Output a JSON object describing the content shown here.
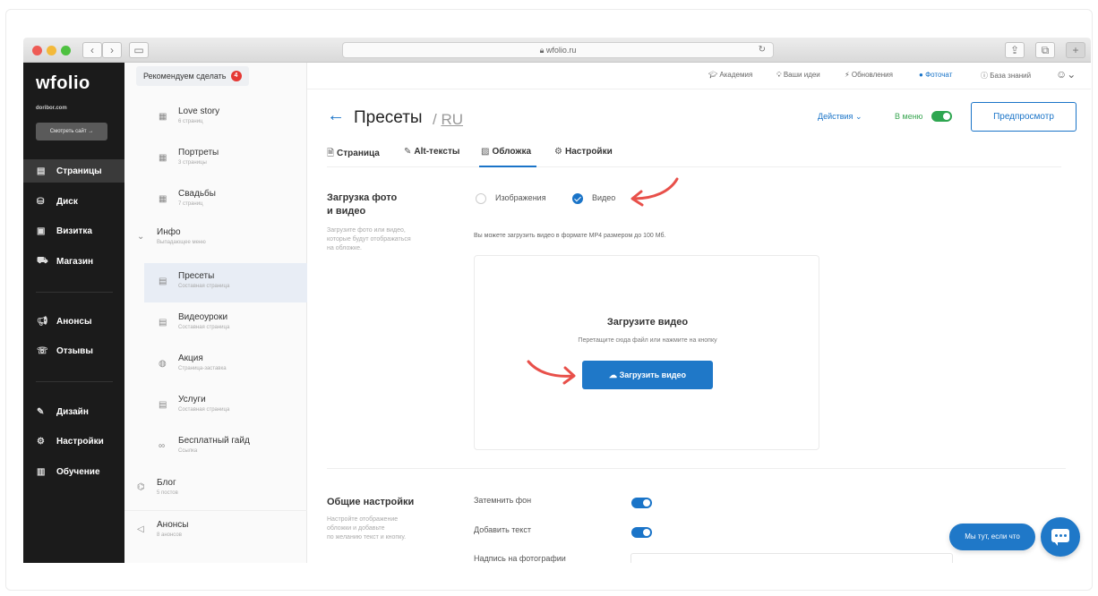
{
  "browser": {
    "address": "wfolio.ru"
  },
  "sidebar": {
    "logo": "wfolio",
    "site": "doribor.com",
    "view_site": "Смотреть сайт →",
    "items": [
      {
        "label": "Страницы",
        "icon": "page-icon"
      },
      {
        "label": "Диск",
        "icon": "disk-icon"
      },
      {
        "label": "Визитка",
        "icon": "card-icon"
      },
      {
        "label": "Магазин",
        "icon": "cart-icon"
      },
      {
        "label": "Анонсы",
        "icon": "megaphone-icon"
      },
      {
        "label": "Отзывы",
        "icon": "reviews-icon"
      },
      {
        "label": "Дизайн",
        "icon": "brush-icon"
      },
      {
        "label": "Настройки",
        "icon": "gear-icon"
      },
      {
        "label": "Обучение",
        "icon": "book-icon"
      }
    ]
  },
  "pages_tree": {
    "recommend": "Рекомендуем сделать",
    "recommend_count": "4",
    "items": [
      {
        "title": "Love story",
        "sub": "6 страниц"
      },
      {
        "title": "Портреты",
        "sub": "3 страницы"
      },
      {
        "title": "Свадьбы",
        "sub": "7 страниц"
      }
    ],
    "group": {
      "title": "Инфо",
      "sub": "Выпадающее меню"
    },
    "children": [
      {
        "title": "Пресеты",
        "sub": "Составная страница"
      },
      {
        "title": "Видеоуроки",
        "sub": "Составная страница"
      },
      {
        "title": "Акция",
        "sub": "Страница-заставка"
      },
      {
        "title": "Услуги",
        "sub": "Составная страница"
      },
      {
        "title": "Бесплатный гайд",
        "sub": "Ссылка"
      }
    ],
    "blog": {
      "title": "Блог",
      "sub": "5 постов"
    },
    "announcements": {
      "title": "Анонсы",
      "sub": "8 анонсов"
    }
  },
  "topbar": {
    "links": [
      "Академия",
      "Ваши идеи",
      "Обновления",
      "Фоточат",
      "База знаний"
    ]
  },
  "page": {
    "title": "Пресеты",
    "lang": "RU",
    "actions": "Действия",
    "in_menu": "В меню",
    "preview": "Предпросмотр",
    "tabs": [
      "Страница",
      "Alt-тексты",
      "Обложка",
      "Настройки"
    ]
  },
  "upload_section": {
    "title_line1": "Загрузка фото",
    "title_line2": "и видео",
    "desc_line1": "Загрузите фото или видео,",
    "desc_line2": "которые будут отображаться",
    "desc_line3": "на обложке.",
    "option_images": "Изображения",
    "option_video": "Видео",
    "selected": "Видео",
    "note": "Вы можете загрузить видео в формате MP4 размером до 100 Мб.",
    "dz_title": "Загрузите видео",
    "dz_sub": "Перетащите сюда файл или нажмите на кнопку",
    "button": "Загрузить видео"
  },
  "general_section": {
    "title": "Общие настройки",
    "desc_line1": "Настройте отображение",
    "desc_line2": "обложки и добавьте",
    "desc_line3": "по желанию текст и кнопку.",
    "darken": "Затемнить фон",
    "darken_on": true,
    "add_text": "Добавить текст",
    "add_text_on": true,
    "caption": "Надпись на фотографии"
  },
  "chat": {
    "pill": "Мы тут, если что"
  }
}
